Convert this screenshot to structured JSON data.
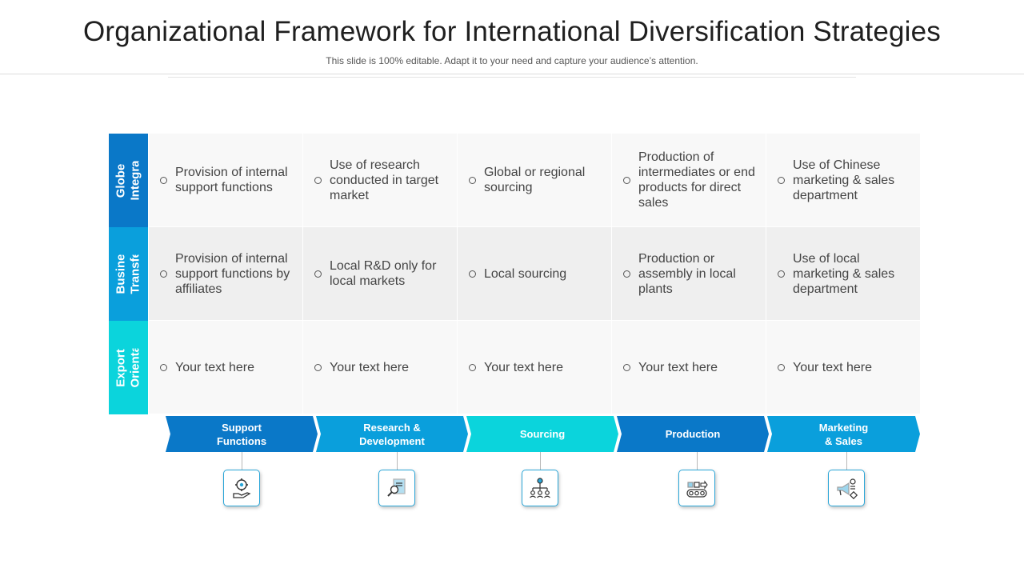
{
  "title": "Organizational Framework for International Diversification Strategies",
  "subtitle": "This slide is 100% editable. Adapt it to your need and capture your audience’s attention.",
  "colors": {
    "dark_blue": "#0a78c8",
    "mid_blue": "#0a9fdc",
    "cyan": "#0bd4dc",
    "cell_light": "#f7f7f7",
    "cell_grey": "#efefef"
  },
  "rows": [
    {
      "label": "Globe Integratio",
      "cells": [
        "Provision of internal support functions",
        "Use of research conducted in target market",
        "Global or regional sourcing",
        "Production of intermediates or end products for direct sales",
        "Use of Chinese marketing & sales department"
      ]
    },
    {
      "label": "Business Transfer",
      "cells": [
        "Provision of internal support functions by affiliates",
        "Local R&D only for local markets",
        "Local sourcing",
        "Production or assembly in local plants",
        "Use of local marketing & sales department"
      ]
    },
    {
      "label": "Export Orientati",
      "cells": [
        "Your text here",
        "Your text here",
        "Your text here",
        "Your text here",
        "Your text here"
      ]
    }
  ],
  "stages": [
    {
      "label": "Support Functions",
      "icon": "gear-hand-icon"
    },
    {
      "label": "Research & Development",
      "icon": "document-magnifier-icon"
    },
    {
      "label": "Sourcing",
      "icon": "network-people-icon"
    },
    {
      "label": "Production",
      "icon": "conveyor-icon"
    },
    {
      "label": "Marketing & Sales",
      "icon": "megaphone-icon"
    }
  ]
}
